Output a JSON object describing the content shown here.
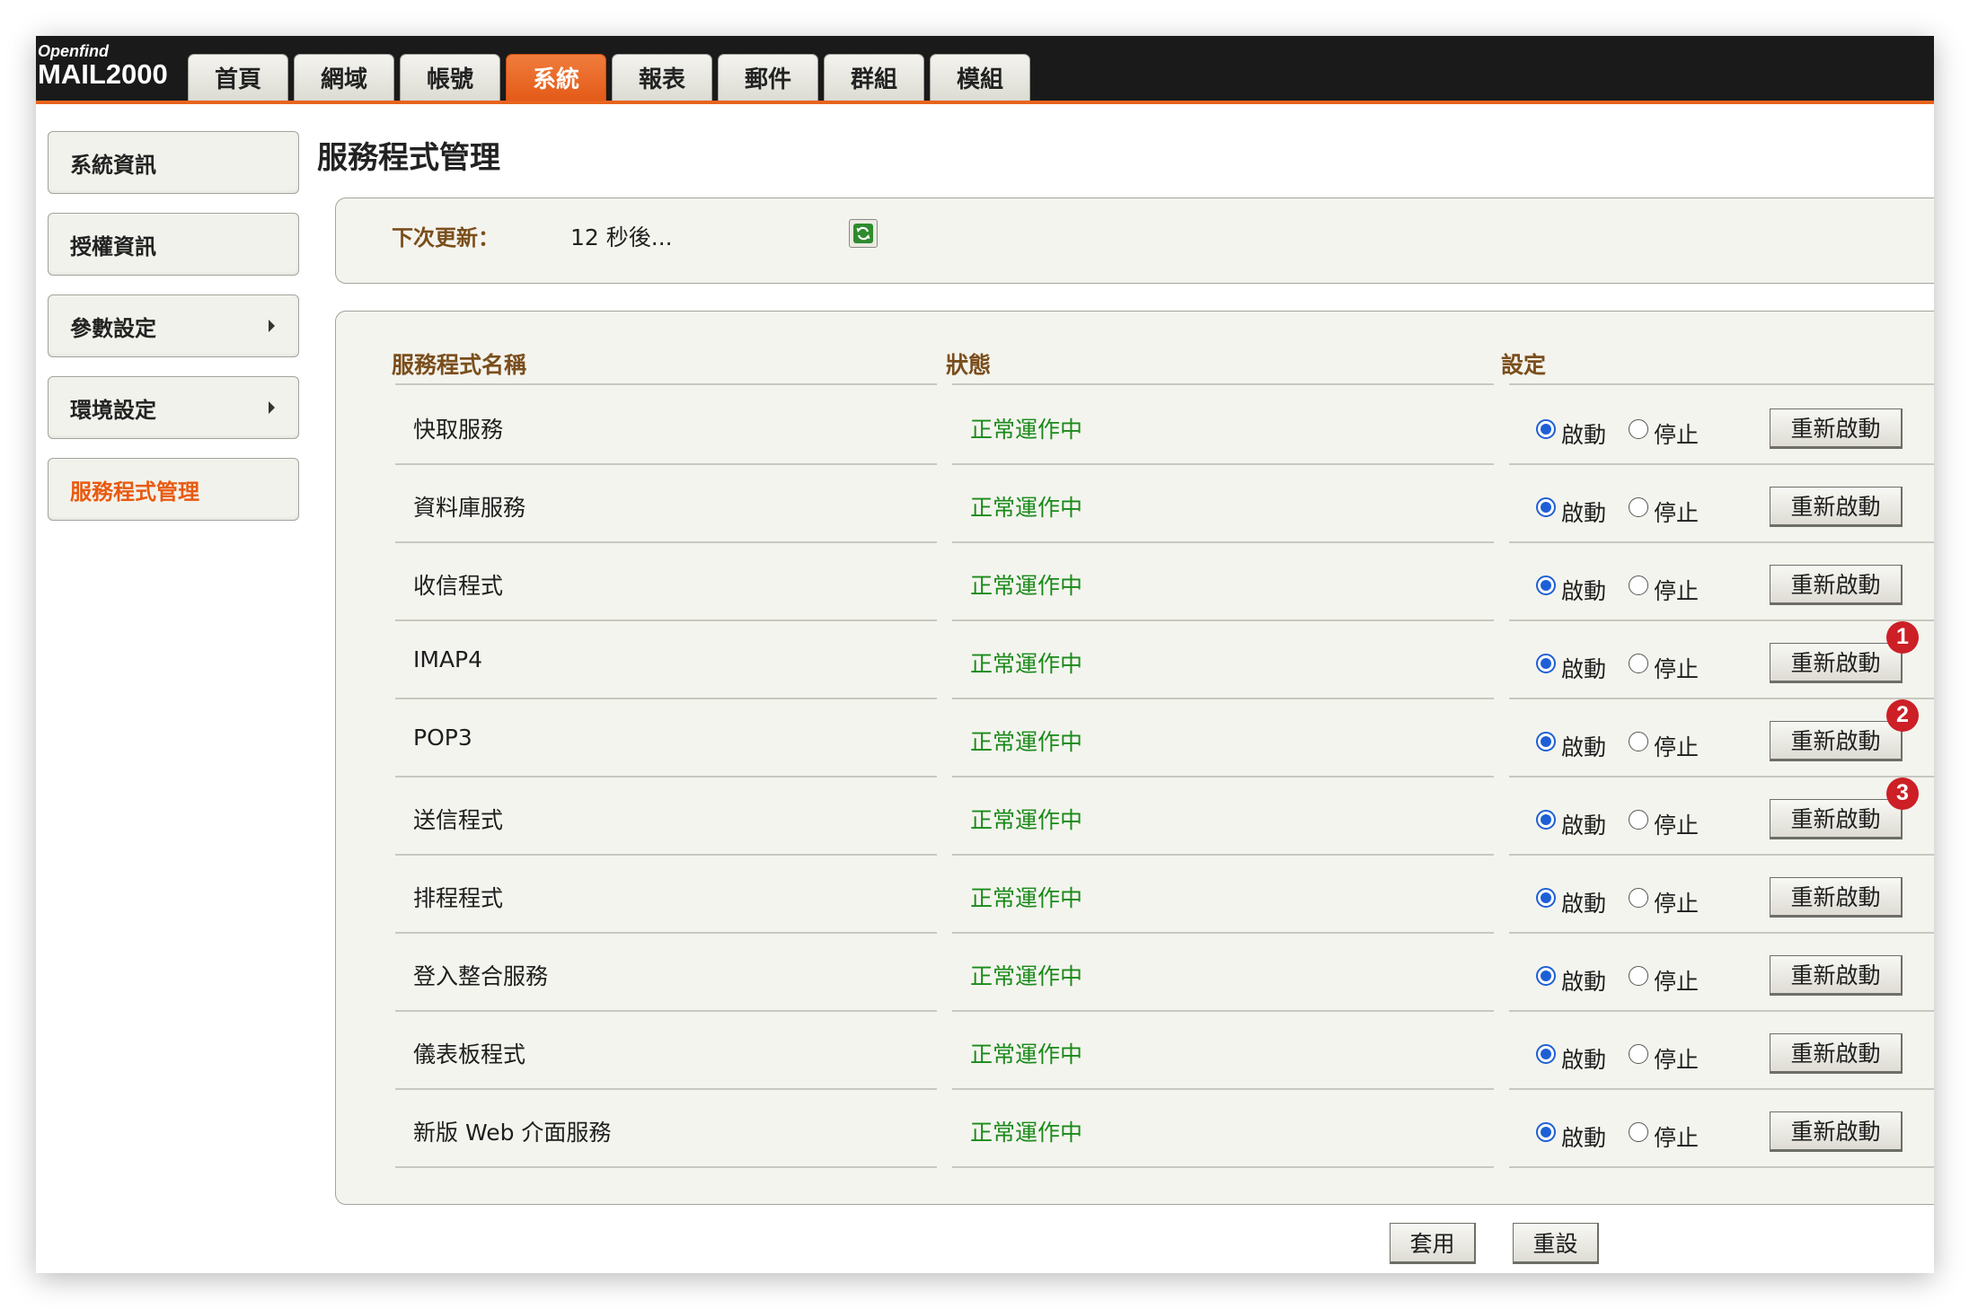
{
  "logo": {
    "brand": "Openfind",
    "product": "MAIL2000"
  },
  "tabs": [
    {
      "label": "首頁",
      "active": false
    },
    {
      "label": "網域",
      "active": false
    },
    {
      "label": "帳號",
      "active": false
    },
    {
      "label": "系統",
      "active": true
    },
    {
      "label": "報表",
      "active": false
    },
    {
      "label": "郵件",
      "active": false
    },
    {
      "label": "群組",
      "active": false
    },
    {
      "label": "模組",
      "active": false
    }
  ],
  "sidebar": {
    "items": [
      {
        "label": "系統資訊",
        "has_submenu": false,
        "active": false
      },
      {
        "label": "授權資訊",
        "has_submenu": false,
        "active": false
      },
      {
        "label": "參數設定",
        "has_submenu": true,
        "active": false
      },
      {
        "label": "環境設定",
        "has_submenu": true,
        "active": false
      },
      {
        "label": "服務程式管理",
        "has_submenu": false,
        "active": true
      }
    ]
  },
  "page_title": "服務程式管理",
  "refresh": {
    "label": "下次更新：",
    "value": "12 秒後..."
  },
  "table": {
    "headers": {
      "name": "服務程式名稱",
      "status": "狀態",
      "setting": "設定"
    },
    "option_start": "啟動",
    "option_stop": "停止",
    "restart_label": "重新啟動",
    "rows": [
      {
        "name": "快取服務",
        "status": "正常運作中",
        "selected": "start"
      },
      {
        "name": "資料庫服務",
        "status": "正常運作中",
        "selected": "start"
      },
      {
        "name": "收信程式",
        "status": "正常運作中",
        "selected": "start"
      },
      {
        "name": "IMAP4",
        "status": "正常運作中",
        "selected": "start",
        "marker": "1"
      },
      {
        "name": "POP3",
        "status": "正常運作中",
        "selected": "start",
        "marker": "2"
      },
      {
        "name": "送信程式",
        "status": "正常運作中",
        "selected": "start",
        "marker": "3"
      },
      {
        "name": "排程程式",
        "status": "正常運作中",
        "selected": "start"
      },
      {
        "name": "登入整合服務",
        "status": "正常運作中",
        "selected": "start"
      },
      {
        "name": "儀表板程式",
        "status": "正常運作中",
        "selected": "start"
      },
      {
        "name": "新版 Web 介面服務",
        "status": "正常運作中",
        "selected": "start"
      }
    ]
  },
  "actions": {
    "apply_label": "套用",
    "reset_label": "重設"
  },
  "colors": {
    "accent": "#e8641e",
    "status_ok": "#1a8a1a",
    "header_text": "#7a4e1c",
    "radio_selected": "#1e5fd6",
    "marker": "#cc1f26"
  }
}
